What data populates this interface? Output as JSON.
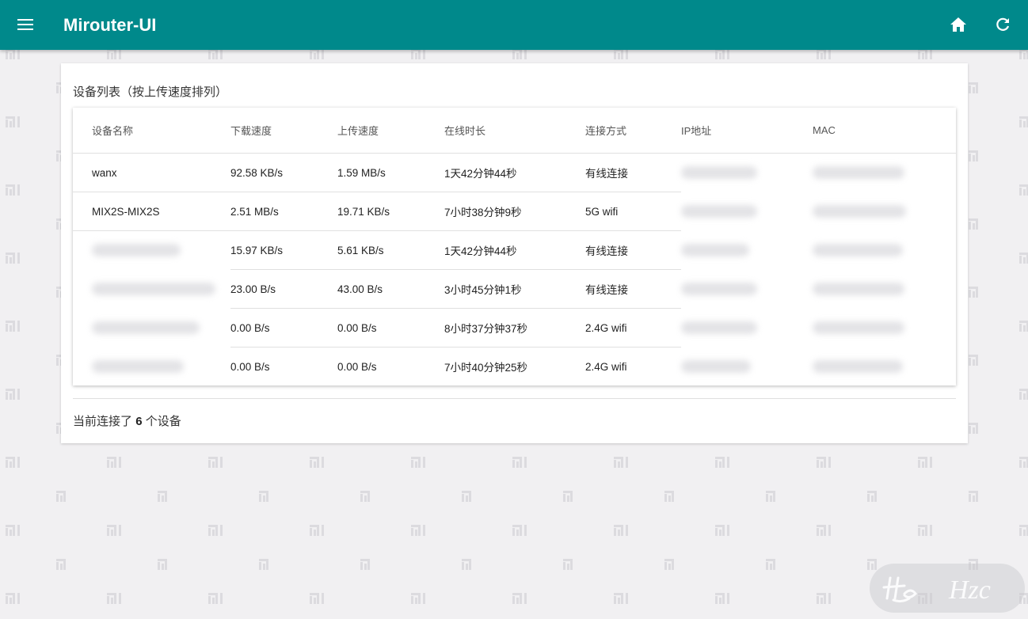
{
  "appbar": {
    "title": "Mirouter-UI",
    "icons": [
      "menu-icon",
      "home-icon",
      "refresh-icon"
    ],
    "color": "#00898b"
  },
  "card": {
    "title": "设备列表（按上传速度排列）",
    "columns": [
      "设备名称",
      "下载速度",
      "上传速度",
      "在线时长",
      "连接方式",
      "IP地址",
      "MAC"
    ],
    "rows": [
      {
        "name": "wanx",
        "download": "92.58 KB/s",
        "upload": "1.59 MB/s",
        "online": "1天42分钟44秒",
        "conn": "有线连接"
      },
      {
        "name": "MIX2S-MIX2S",
        "download": "2.51 MB/s",
        "upload": "19.71 KB/s",
        "online": "7小时38分钟9秒",
        "conn": "5G wifi"
      },
      {
        "name": "",
        "download": "15.97 KB/s",
        "upload": "5.61 KB/s",
        "online": "1天42分钟44秒",
        "conn": "有线连接"
      },
      {
        "name": "",
        "download": "23.00 B/s",
        "upload": "43.00 B/s",
        "online": "3小时45分钟1秒",
        "conn": "有线连接"
      },
      {
        "name": "",
        "download": "0.00 B/s",
        "upload": "0.00 B/s",
        "online": "8小时37分钟37秒",
        "conn": "2.4G wifi"
      },
      {
        "name": "",
        "download": "0.00 B/s",
        "upload": "0.00 B/s",
        "online": "7小时40分钟25秒",
        "conn": "2.4G wifi"
      }
    ],
    "summary_prefix": "当前连接了",
    "summary_count": "6",
    "summary_suffix": "个设备"
  },
  "watermark": "Hzc"
}
